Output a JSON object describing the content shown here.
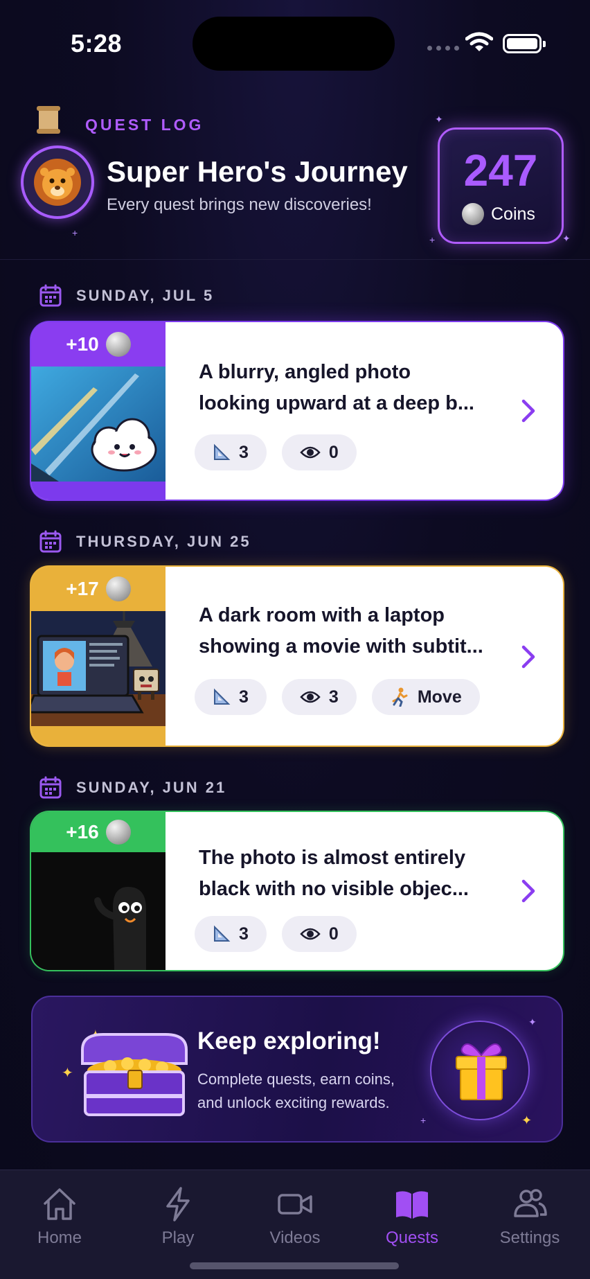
{
  "status_bar": {
    "time": "5:28"
  },
  "header": {
    "section_label": "QUEST LOG",
    "title": "Super Hero's Journey",
    "subtitle": "Every quest brings new discoveries!",
    "avatar_icon": "lion-avatar-icon",
    "coins": {
      "value": "247",
      "label": "Coins"
    }
  },
  "quests": [
    {
      "date": "SUNDAY, JUL 5",
      "reward": "+10",
      "accent": "#7c3aed",
      "thumbnail": "sky-cloud-illustration",
      "description_line1": "A blurry, angled photo",
      "description_line2": "looking upward at a deep b...",
      "chips": [
        {
          "icon": "triangle-ruler-icon",
          "value": "3"
        },
        {
          "icon": "eye-icon",
          "value": "0"
        }
      ]
    },
    {
      "date": "THURSDAY, JUN 25",
      "reward": "+17",
      "accent": "#e9b13a",
      "thumbnail": "laptop-room-illustration",
      "description_line1": "A dark room with a laptop",
      "description_line2": "showing a movie with subtit...",
      "chips": [
        {
          "icon": "triangle-ruler-icon",
          "value": "3"
        },
        {
          "icon": "eye-icon",
          "value": "3"
        },
        {
          "icon": "running-person-icon",
          "value": "Move"
        }
      ]
    },
    {
      "date": "SUNDAY, JUN 21",
      "reward": "+16",
      "accent": "#34c15c",
      "thumbnail": "shadow-creature-illustration",
      "description_line1": "The photo is almost entirely",
      "description_line2": "black with no visible objec...",
      "chips": [
        {
          "icon": "triangle-ruler-icon",
          "value": "3"
        },
        {
          "icon": "eye-icon",
          "value": "0"
        }
      ]
    }
  ],
  "banner": {
    "title": "Keep exploring!",
    "text": "Complete quests, earn coins, and unlock exciting rewards."
  },
  "tab_bar": {
    "active": "Quests",
    "tabs": [
      {
        "label": "Home",
        "icon": "house-icon"
      },
      {
        "label": "Play",
        "icon": "lightning-icon"
      },
      {
        "label": "Videos",
        "icon": "video-camera-icon"
      },
      {
        "label": "Quests",
        "icon": "open-book-icon"
      },
      {
        "label": "Settings",
        "icon": "people-icon"
      }
    ]
  },
  "colors": {
    "background": "#0c0a1f",
    "accent_purple": "#a95bff",
    "tab_active": "#a14ff3",
    "tab_inactive": "#7e7b96"
  }
}
